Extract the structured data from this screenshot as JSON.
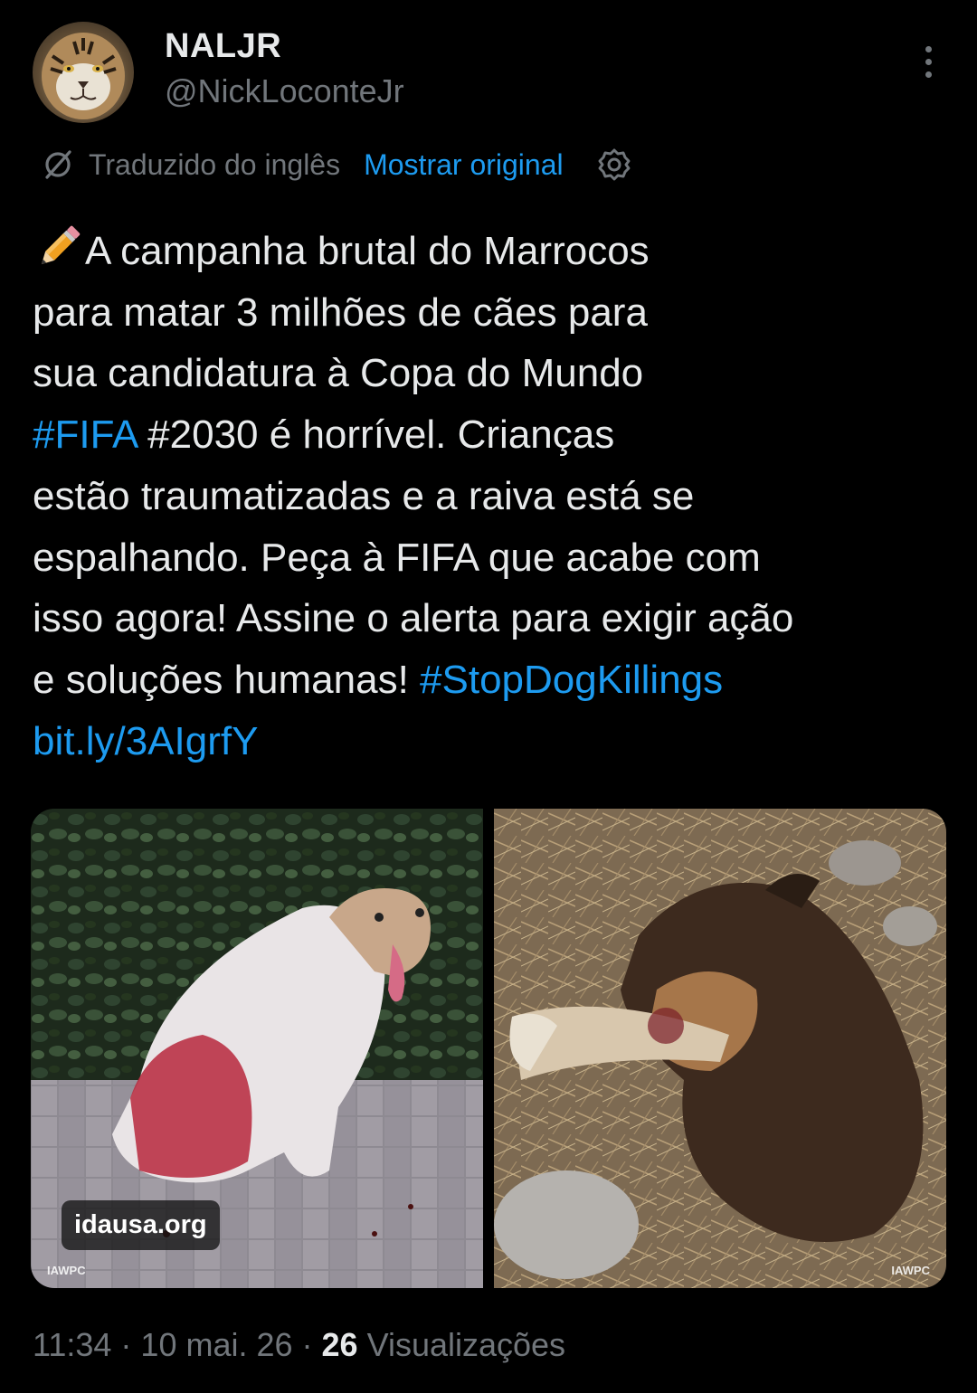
{
  "author": {
    "name": "NALJR",
    "handle": "@NickLoconteJr",
    "avatar_icon": "tiger-avatar"
  },
  "translation": {
    "icon": "translate-icon",
    "label": "Traduzido do inglês",
    "show_original": "Mostrar original",
    "settings_icon": "gear-icon"
  },
  "tweet": {
    "emoji": "pencil-icon",
    "segments": [
      {
        "text": "A campanha brutal do Marrocos\npara matar 3 milhões de cães para\nsua candidatura à Copa do Mundo\n",
        "link": false
      },
      {
        "text": "#FIFA",
        "link": true
      },
      {
        "text": " #2030 é horrível. Crianças\nestão traumatizadas e a raiva está se\nespalhando. Peça à FIFA que acabe com\nisso agora! Assine o alerta para exigir ação\ne soluções humanas! ",
        "link": false
      },
      {
        "text": "#StopDogKillings",
        "link": true
      },
      {
        "text": "\n",
        "link": false
      },
      {
        "text": "bit.ly/3AIgrfY",
        "link": true
      }
    ]
  },
  "media": {
    "photo1": {
      "source": "idausa.org",
      "watermark": "IAWPC"
    },
    "photo2": {
      "watermark": "IAWPC"
    }
  },
  "meta": {
    "time": "11:34",
    "separator": " · ",
    "date": "10 mai. 26",
    "views_count": "26",
    "views_label": " Visualizações"
  },
  "colors": {
    "background": "#000000",
    "text": "#e7e9ea",
    "secondary": "#71767b",
    "accent": "#1d9bf0"
  }
}
